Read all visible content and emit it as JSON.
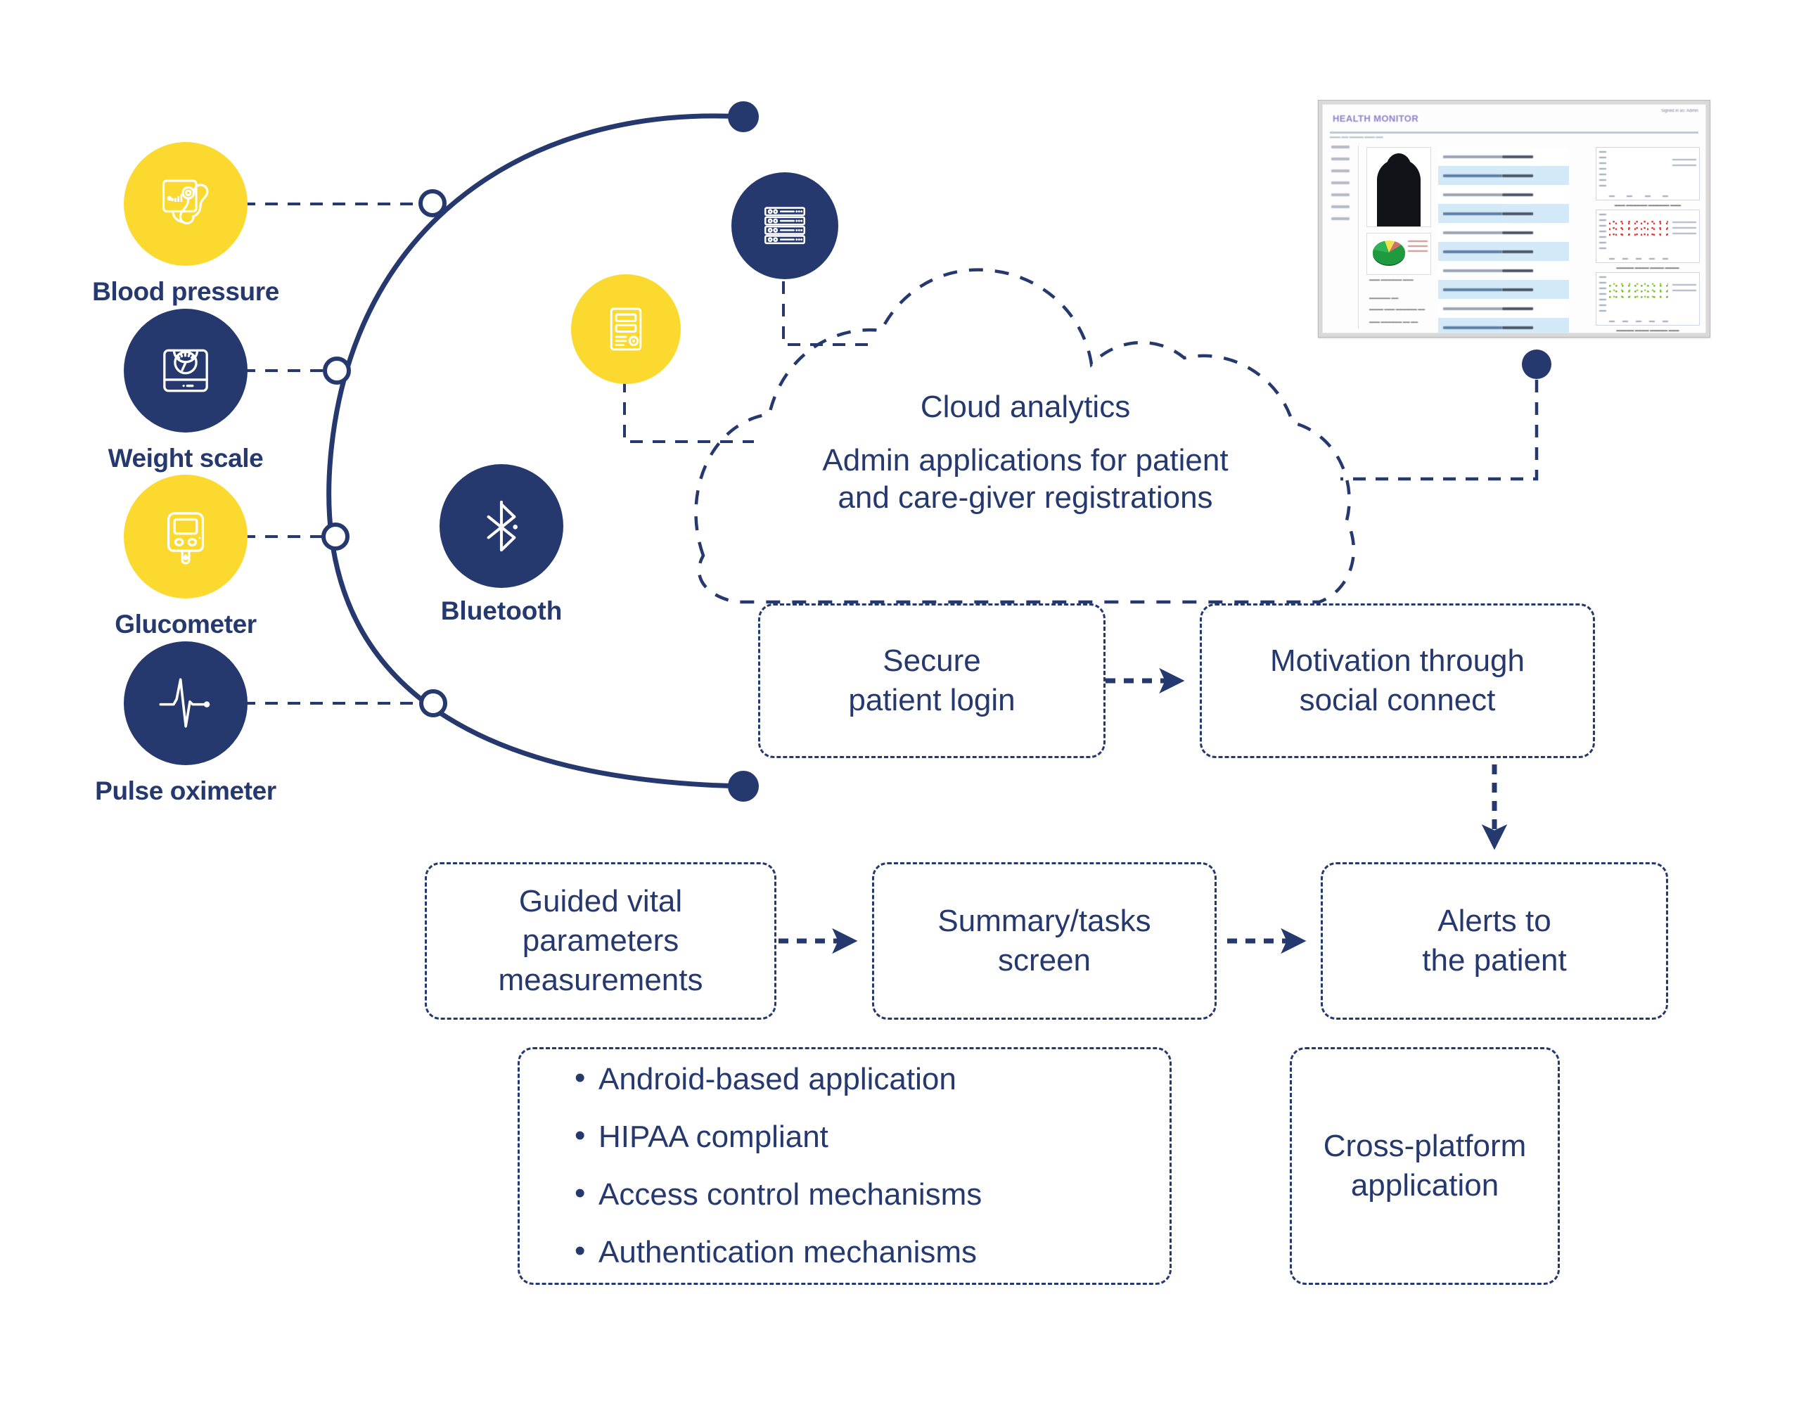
{
  "palette": {
    "navy": "#26396F",
    "yellow": "#FBD92E",
    "white": "#FFFFFF",
    "dashboard_title_purple": "#8D7FC6"
  },
  "devices": [
    {
      "label": "Blood pressure",
      "icon": "blood-pressure-monitor-icon",
      "style": "yellow"
    },
    {
      "label": "Weight scale",
      "icon": "weight-scale-icon",
      "style": "navy"
    },
    {
      "label": "Glucometer",
      "icon": "glucometer-icon",
      "style": "yellow"
    },
    {
      "label": "Pulse oximeter",
      "icon": "pulse-oximeter-icon",
      "style": "navy"
    }
  ],
  "connectivity": {
    "label": "Bluetooth",
    "icon": "bluetooth-icon"
  },
  "infrastructure": [
    {
      "icon": "server-rack-icon",
      "style": "navy",
      "name": "server-node"
    },
    {
      "icon": "gateway-device-icon",
      "style": "yellow",
      "name": "gateway-node"
    }
  ],
  "cloud": {
    "title": "Cloud analytics",
    "subtitle_line1": "Admin applications for patient",
    "subtitle_line2": "and care-giver registrations"
  },
  "flow": {
    "secure_login": "Secure\npatient login",
    "secure_login_l1": "Secure",
    "secure_login_l2": "patient login",
    "motivation_l1": "Motivation through",
    "motivation_l2": "social connect",
    "guided_l1": "Guided vital",
    "guided_l2": "parameters",
    "guided_l3": "measurements",
    "summary_l1": "Summary/tasks",
    "summary_l2": "screen",
    "alerts_l1": "Alerts to",
    "alerts_l2": "the patient",
    "cross_platform_l1": "Cross-platform",
    "cross_platform_l2": "application"
  },
  "requirements": [
    "Android-based application",
    "HIPAA compliant",
    "Access control mechanisms",
    "Authentication mechanisms"
  ],
  "dashboard": {
    "title": "HEALTH MONITOR",
    "user_label": "Signed in as: Admin"
  }
}
